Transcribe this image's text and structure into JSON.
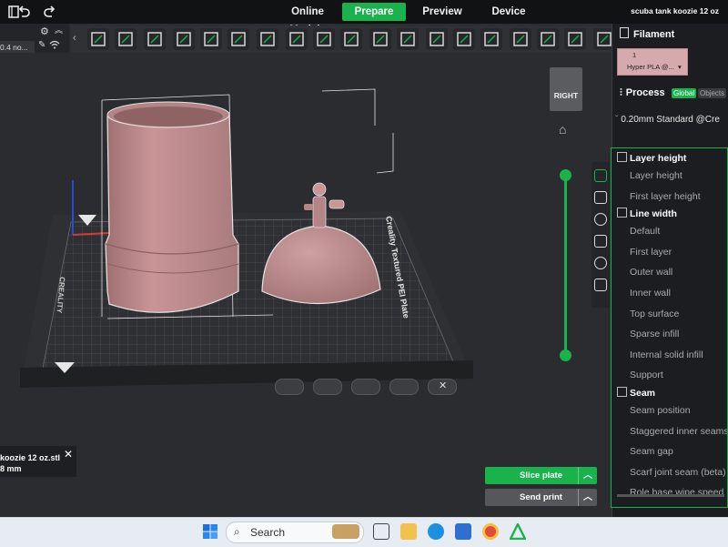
{
  "topbar": {
    "tabs": [
      "Online Models",
      "Prepare",
      "Preview",
      "Device"
    ],
    "active_tab": "Prepare",
    "document_title": "scuba tank koozie 12 oz"
  },
  "left_panel": {
    "printer_label": "0.4 no..."
  },
  "viewport": {
    "view_cube_label": "RIGHT",
    "plate_label": "Creality Textured PEI Plate",
    "brand_label": "CREALITY"
  },
  "object_info": {
    "name": "koozie 12 oz.stl",
    "size": "8 mm"
  },
  "actions": {
    "slice": "Slice plate",
    "send": "Send print"
  },
  "right_panel": {
    "filament_header": "Filament",
    "filament_slot": "1",
    "filament_name": "Hyper PLA @...",
    "filament_color": "#d6a9ac",
    "process_header": "Process",
    "toggle_global": "Global",
    "toggle_objects": "Objects",
    "profile": "0.20mm Standard @Cre",
    "sections": [
      {
        "title": "Layer height",
        "items": [
          "Layer height",
          "First layer height"
        ]
      },
      {
        "title": "Line width",
        "items": [
          "Default",
          "First layer",
          "Outer wall",
          "Inner wall",
          "Top surface",
          "Sparse infill",
          "Internal solid infill",
          "Support"
        ]
      },
      {
        "title": "Seam",
        "items": [
          "Seam position",
          "Staggered inner seams",
          "Seam gap",
          "Scarf joint seam (beta)",
          "Role base wipe speed"
        ]
      }
    ]
  },
  "taskbar": {
    "search_placeholder": "Search"
  },
  "colors": {
    "accent": "#19b24b",
    "model": "#c99597",
    "bed": "#3a3b3e"
  }
}
